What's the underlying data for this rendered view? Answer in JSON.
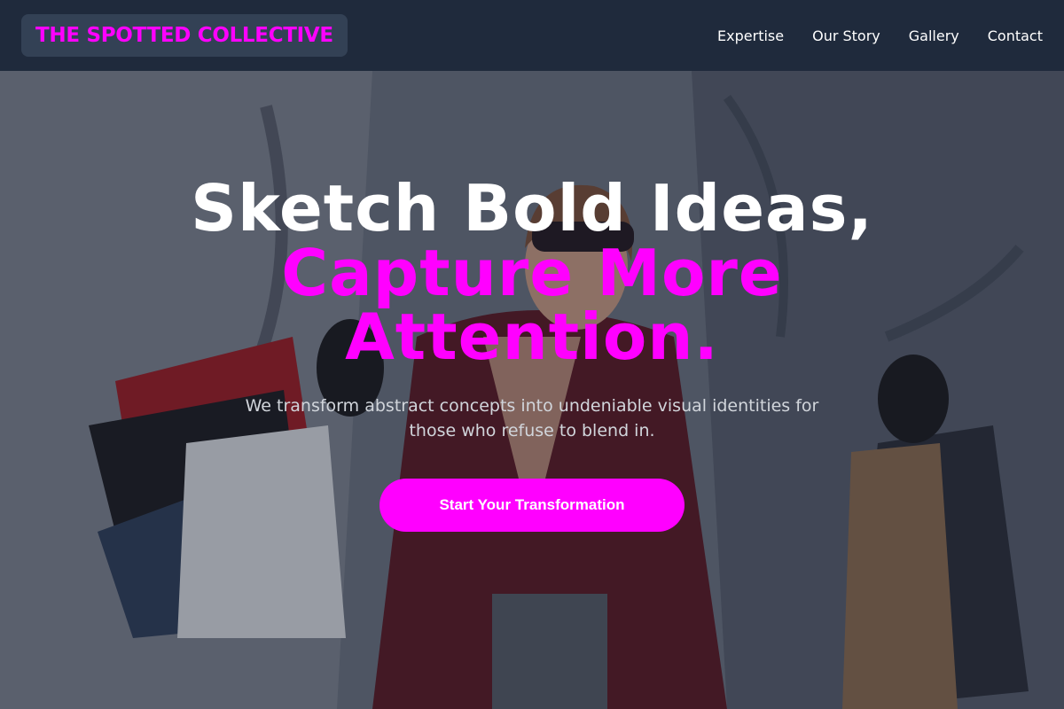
{
  "header": {
    "logo": "THE SPOTTED COLLECTIVE",
    "nav": [
      "Expertise",
      "Our Story",
      "Gallery",
      "Contact"
    ]
  },
  "hero": {
    "headline_line1": "Sketch Bold Ideas,",
    "headline_line2": "Capture More Attention.",
    "subtext": "We transform abstract concepts into undeniable visual identities for those who refuse to blend in.",
    "cta": "Start Your Transformation",
    "background_image": "woman-with-shopping-bags-photo"
  },
  "colors": {
    "accent": "#ff00ff",
    "header_bg": "#1f2a3c",
    "logo_bg": "#334155"
  }
}
